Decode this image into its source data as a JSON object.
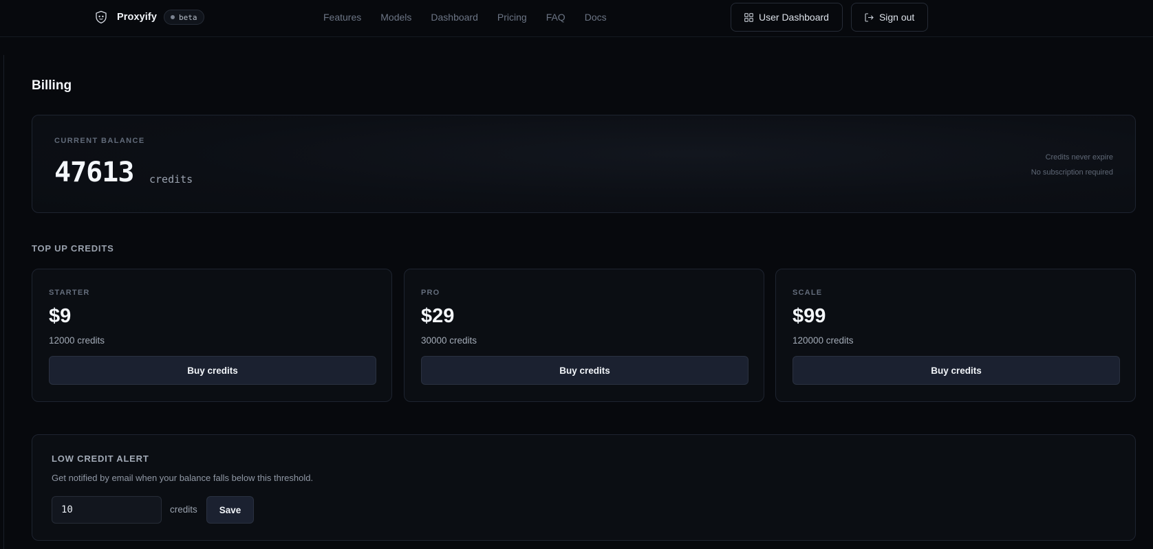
{
  "brand": {
    "name": "Proxyify",
    "badge": "beta",
    "logo_icon": "shield-logo-icon"
  },
  "nav": {
    "links": [
      {
        "label": "Features"
      },
      {
        "label": "Models"
      },
      {
        "label": "Dashboard"
      },
      {
        "label": "Pricing"
      },
      {
        "label": "FAQ"
      },
      {
        "label": "Docs"
      }
    ],
    "actions": {
      "dashboard_label": "User Dashboard",
      "dashboard_icon": "grid-icon",
      "signout_label": "Sign out",
      "signout_icon": "sign-out-icon"
    }
  },
  "page": {
    "title": "Billing"
  },
  "balance": {
    "label": "CURRENT BALANCE",
    "value": "47613",
    "unit": "credits",
    "notes": [
      "Credits never expire",
      "No subscription required"
    ]
  },
  "topup": {
    "heading": "TOP UP CREDITS",
    "plans": [
      {
        "name": "STARTER",
        "price": "$9",
        "credits": "12000 credits",
        "button": "Buy credits"
      },
      {
        "name": "PRO",
        "price": "$29",
        "credits": "30000 credits",
        "button": "Buy credits"
      },
      {
        "name": "SCALE",
        "price": "$99",
        "credits": "120000 credits",
        "button": "Buy credits"
      }
    ]
  },
  "alert": {
    "title": "LOW CREDIT ALERT",
    "description": "Get notified by email when your balance falls below this threshold.",
    "input_value": "10",
    "unit": "credits",
    "save_label": "Save"
  },
  "colors": {
    "background": "#07090d",
    "card": "#0b0e13",
    "button": "#1b2130",
    "border": "#1e2430",
    "text_primary": "#f4f7fb",
    "text_muted": "#6c7585"
  }
}
